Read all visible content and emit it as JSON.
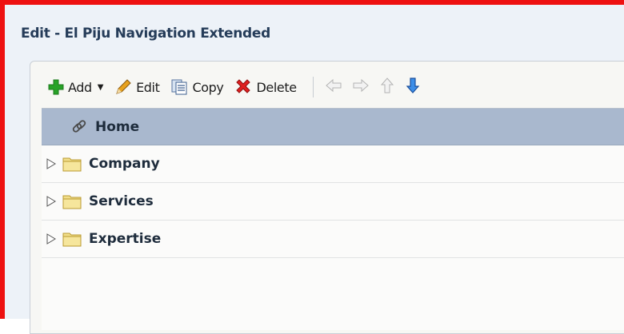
{
  "window": {
    "title": "Edit - El Piju Navigation Extended"
  },
  "colors": {
    "frame_border": "#ee1111",
    "selected_row": "#a9b8ce"
  },
  "toolbar": {
    "add_label": "Add",
    "edit_label": "Edit",
    "copy_label": "Copy",
    "delete_label": "Delete",
    "icons": [
      "plus-icon",
      "pencil-icon",
      "copy-icon",
      "delete-x-icon",
      "arrow-left-icon",
      "arrow-right-icon",
      "arrow-up-icon",
      "arrow-down-icon"
    ]
  },
  "tree": {
    "items": [
      {
        "label": "Home",
        "icon": "link-icon",
        "selected": true
      },
      {
        "label": "Company",
        "icon": "folder-icon"
      },
      {
        "label": "Services",
        "icon": "folder-icon"
      },
      {
        "label": "Expertise",
        "icon": "folder-icon"
      }
    ]
  }
}
